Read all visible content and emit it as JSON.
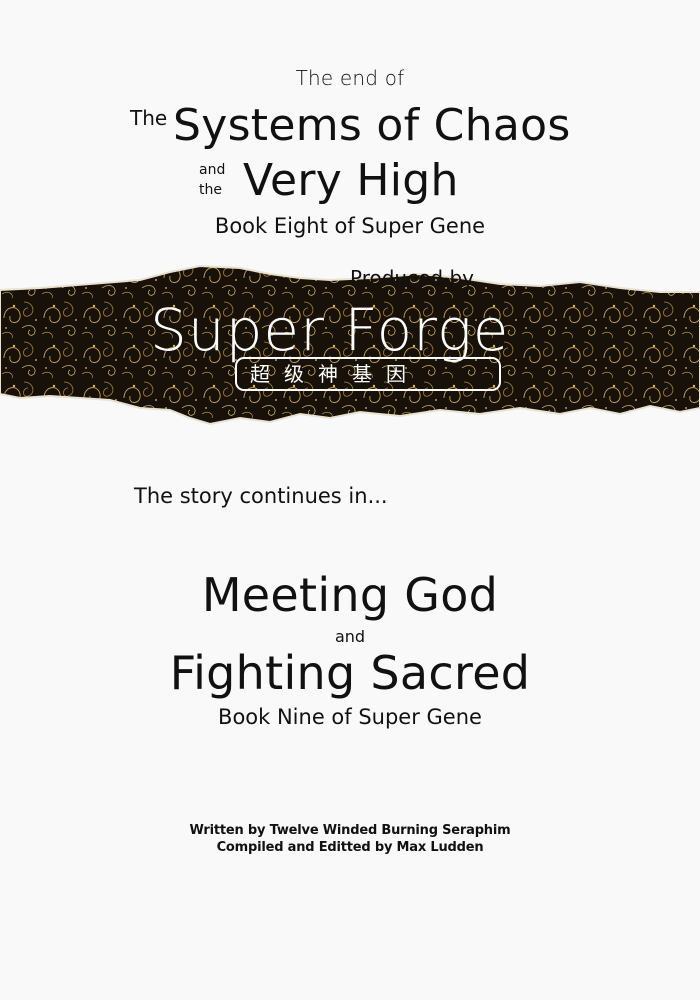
{
  "header": {
    "end_of": "The end of",
    "the": "The",
    "title_line1": "Systems of Chaos",
    "and": "and",
    "the2": "the",
    "title_line2": "Very High",
    "subtitle": "Book Eight of Super Gene"
  },
  "banner": {
    "produced_by": "Produced by",
    "studio_name": "Super Forge",
    "chinese_title": "超级神基因",
    "colors": {
      "background": "#1a140a",
      "accent": "#c9a24e",
      "text": "#ffffff"
    }
  },
  "next": {
    "continues": "The story continues in...",
    "title_line1": "Meeting God",
    "and": "and",
    "title_line2": "Fighting Sacred",
    "subtitle": "Book Nine of Super Gene"
  },
  "credits": {
    "written_by": "Written by Twelve Winded Burning Seraphim",
    "edited_by": "Compiled and Editted by Max Ludden"
  }
}
